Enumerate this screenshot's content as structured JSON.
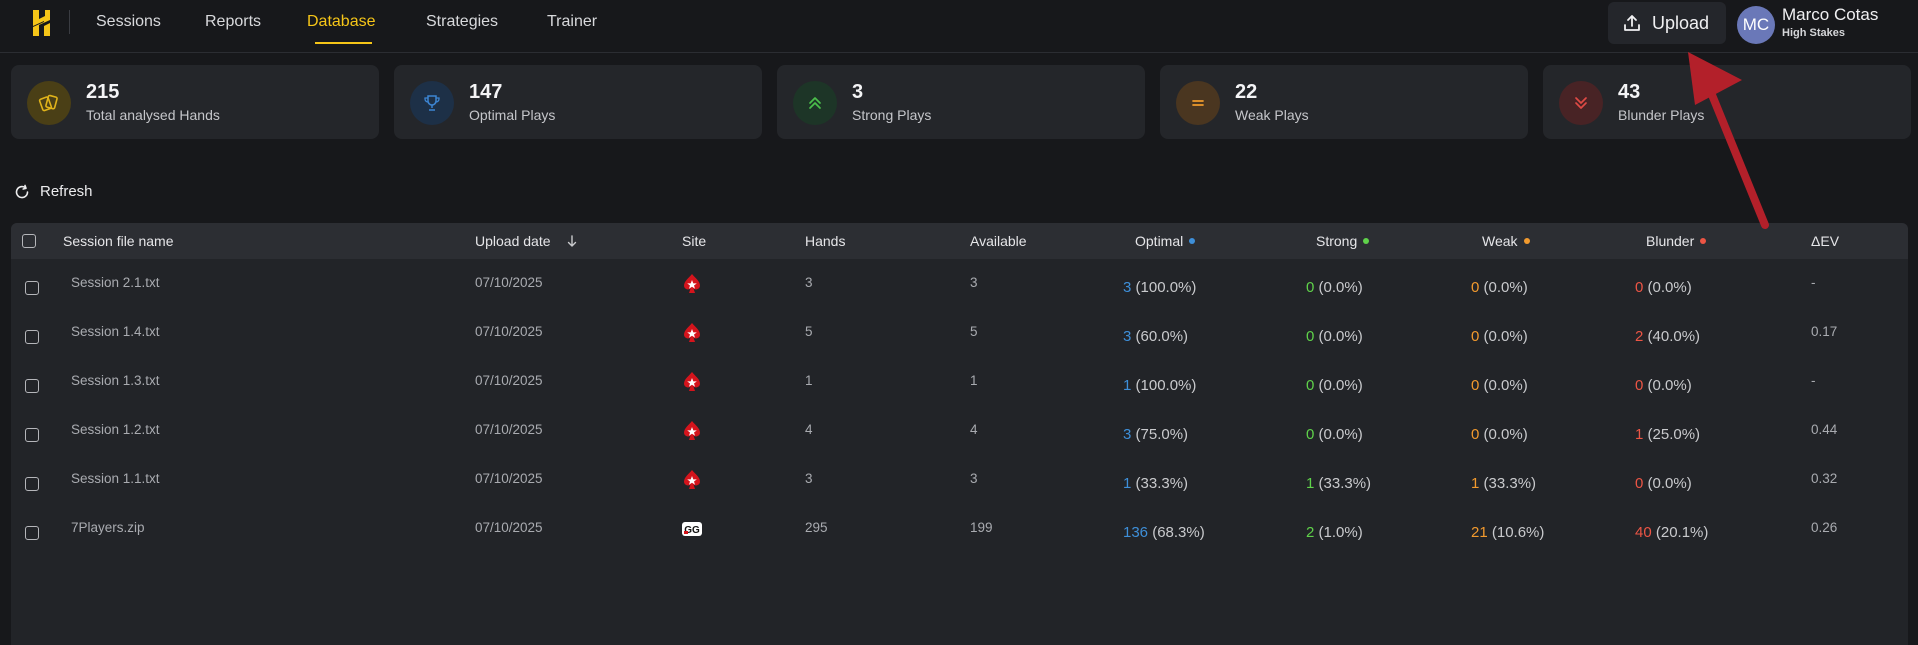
{
  "nav": {
    "items": [
      {
        "label": "Sessions",
        "active": false
      },
      {
        "label": "Reports",
        "active": false
      },
      {
        "label": "Database",
        "active": true
      },
      {
        "label": "Strategies",
        "active": false
      },
      {
        "label": "Trainer",
        "active": false
      }
    ],
    "upload_label": "Upload",
    "user": {
      "initials": "MC",
      "name": "Marco Cotas",
      "tier": "High Stakes"
    }
  },
  "stats": [
    {
      "value": "215",
      "label": "Total analysed Hands",
      "icon": "cards-icon",
      "color": "#e0b31a"
    },
    {
      "value": "147",
      "label": "Optimal Plays",
      "icon": "trophy-icon",
      "color": "#3d86d4"
    },
    {
      "value": "3",
      "label": "Strong Plays",
      "icon": "double-chevron-up-icon",
      "color": "#4bbf4b"
    },
    {
      "value": "22",
      "label": "Weak Plays",
      "icon": "equals-icon",
      "color": "#ef9a2b"
    },
    {
      "value": "43",
      "label": "Blunder Plays",
      "icon": "double-chevron-down-icon",
      "color": "#e04a45"
    }
  ],
  "refresh_label": "Refresh",
  "table": {
    "headers": {
      "file": "Session file name",
      "date": "Upload date",
      "site": "Site",
      "hands": "Hands",
      "available": "Available",
      "optimal": "Optimal",
      "strong": "Strong",
      "weak": "Weak",
      "blunder": "Blunder",
      "ev": "ΔEV"
    },
    "rows": [
      {
        "file": "Session 2.1.txt",
        "date": "07/10/2025",
        "site": "pokerstars-icon",
        "hands": "3",
        "available": "3",
        "optimal": {
          "n": "3",
          "pct": "(100.0%)"
        },
        "strong": {
          "n": "0",
          "pct": "(0.0%)"
        },
        "weak": {
          "n": "0",
          "pct": "(0.0%)"
        },
        "blunder": {
          "n": "0",
          "pct": "(0.0%)"
        },
        "ev": "-"
      },
      {
        "file": "Session 1.4.txt",
        "date": "07/10/2025",
        "site": "pokerstars-icon",
        "hands": "5",
        "available": "5",
        "optimal": {
          "n": "3",
          "pct": "(60.0%)"
        },
        "strong": {
          "n": "0",
          "pct": "(0.0%)"
        },
        "weak": {
          "n": "0",
          "pct": "(0.0%)"
        },
        "blunder": {
          "n": "2",
          "pct": "(40.0%)"
        },
        "ev": "0.17"
      },
      {
        "file": "Session 1.3.txt",
        "date": "07/10/2025",
        "site": "pokerstars-icon",
        "hands": "1",
        "available": "1",
        "optimal": {
          "n": "1",
          "pct": "(100.0%)"
        },
        "strong": {
          "n": "0",
          "pct": "(0.0%)"
        },
        "weak": {
          "n": "0",
          "pct": "(0.0%)"
        },
        "blunder": {
          "n": "0",
          "pct": "(0.0%)"
        },
        "ev": "-"
      },
      {
        "file": "Session 1.2.txt",
        "date": "07/10/2025",
        "site": "pokerstars-icon",
        "hands": "4",
        "available": "4",
        "optimal": {
          "n": "3",
          "pct": "(75.0%)"
        },
        "strong": {
          "n": "0",
          "pct": "(0.0%)"
        },
        "weak": {
          "n": "0",
          "pct": "(0.0%)"
        },
        "blunder": {
          "n": "1",
          "pct": "(25.0%)"
        },
        "ev": "0.44"
      },
      {
        "file": "Session 1.1.txt",
        "date": "07/10/2025",
        "site": "pokerstars-icon",
        "hands": "3",
        "available": "3",
        "optimal": {
          "n": "1",
          "pct": "(33.3%)"
        },
        "strong": {
          "n": "1",
          "pct": "(33.3%)"
        },
        "weak": {
          "n": "1",
          "pct": "(33.3%)"
        },
        "blunder": {
          "n": "0",
          "pct": "(0.0%)"
        },
        "ev": "0.32"
      },
      {
        "file": "7Players.zip",
        "date": "07/10/2025",
        "site": "ggpoker-icon",
        "hands": "295",
        "available": "199",
        "optimal": {
          "n": "136",
          "pct": "(68.3%)"
        },
        "strong": {
          "n": "2",
          "pct": "(1.0%)"
        },
        "weak": {
          "n": "21",
          "pct": "(10.6%)"
        },
        "blunder": {
          "n": "40",
          "pct": "(20.1%)"
        },
        "ev": "0.26"
      }
    ]
  },
  "colors": {
    "accent": "#f5c518",
    "optimal": "#3e8fd9",
    "strong": "#5fd24a",
    "weak": "#f29a2e",
    "blunder": "#ec5545",
    "annotation_arrow": "#b3202a"
  }
}
